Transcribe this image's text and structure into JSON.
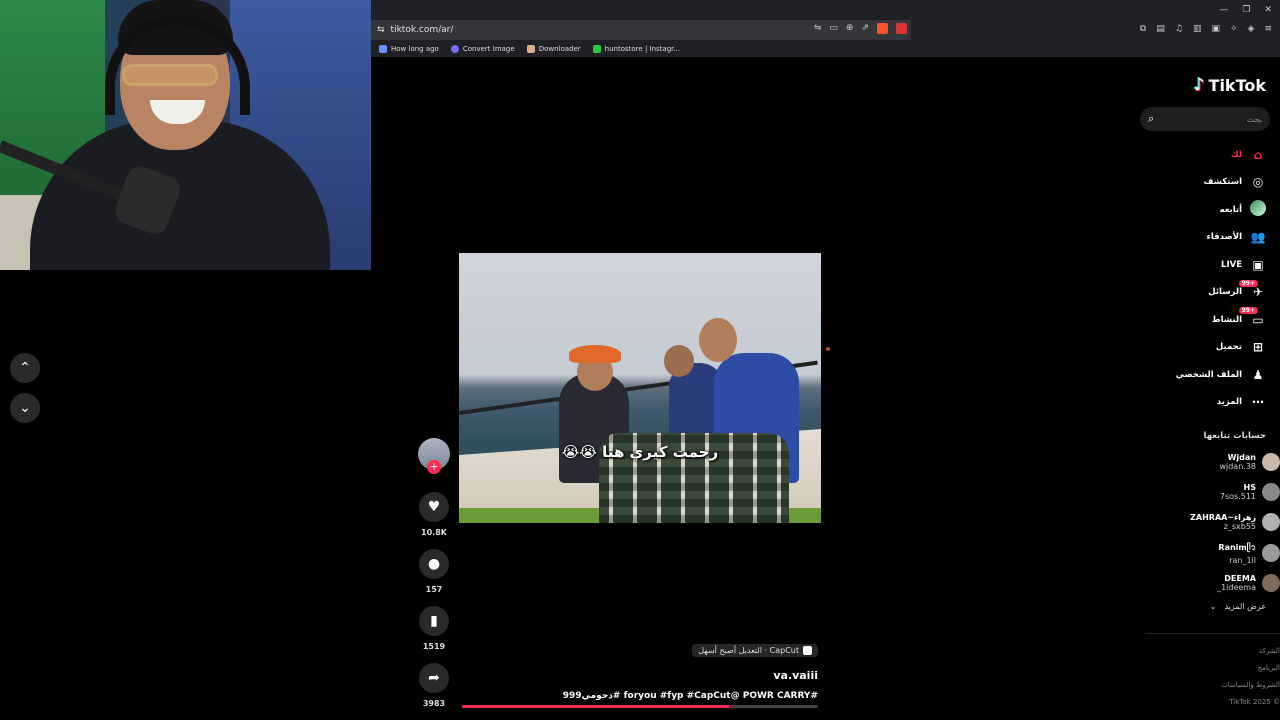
{
  "browser": {
    "url": "tiktok.com/ar/",
    "bookmarks": [
      {
        "label": "How long ago",
        "color": "#6b8cff"
      },
      {
        "label": "Convert Image",
        "color": "#7a6cff"
      },
      {
        "label": "Downloader",
        "color": "#d9b08c"
      },
      {
        "label": "huntostore | Instagr...",
        "color": "#28c840"
      }
    ]
  },
  "sidebar": {
    "logo": "TikTok",
    "search_placeholder": "بحث",
    "menu": [
      {
        "label": "لك",
        "icon": "home-icon",
        "glyph": "⌂",
        "active": true
      },
      {
        "label": "استكشف",
        "icon": "compass-icon",
        "glyph": "◎"
      },
      {
        "label": "أتابعه",
        "icon": "following-avatar-icon",
        "glyph": ""
      },
      {
        "label": "الأصدقاء",
        "icon": "friends-icon",
        "glyph": "👥"
      },
      {
        "label": "LIVE",
        "icon": "live-icon",
        "glyph": "▣"
      },
      {
        "label": "الرسائل",
        "icon": "messages-icon",
        "glyph": "✈",
        "badge": "99+"
      },
      {
        "label": "النشاط",
        "icon": "activity-icon",
        "glyph": "▭",
        "badge": "99+"
      },
      {
        "label": "تحميل",
        "icon": "upload-icon",
        "glyph": "⊞"
      },
      {
        "label": "الملف الشخصي",
        "icon": "profile-icon",
        "glyph": "♟"
      },
      {
        "label": "المزيد",
        "icon": "more-icon",
        "glyph": "⋯"
      }
    ],
    "following_title": "حسابات تتابعها",
    "accounts": [
      {
        "name": "Wjdan",
        "handle": "wjdan.38"
      },
      {
        "name": "HS",
        "handle": "7sos.511"
      },
      {
        "name": "ZAHRAA~زهراء",
        "handle": "z_sxb55"
      },
      {
        "name": "Ranimᥫ᭡",
        "handle": "ran_1il"
      },
      {
        "name": "DEEMA",
        "handle": "_1ideema"
      }
    ],
    "show_more": "عرض المزيد",
    "footer": [
      "الشركة",
      "البرنامج",
      "الشروط والسياسات",
      "© 2025 TikTok"
    ]
  },
  "video": {
    "caption": "رحمت كيري هنا 😭😭",
    "likes": "10.8K",
    "comments": "157",
    "saves": "1519",
    "shares": "3983",
    "capcut_label": "CapCut · التعديل أصبح أسهل",
    "author": "va.vaiii",
    "description": "#foryou #fyp #CapCut@ POWR CARRY #دحومي999",
    "progress": 0.75
  }
}
